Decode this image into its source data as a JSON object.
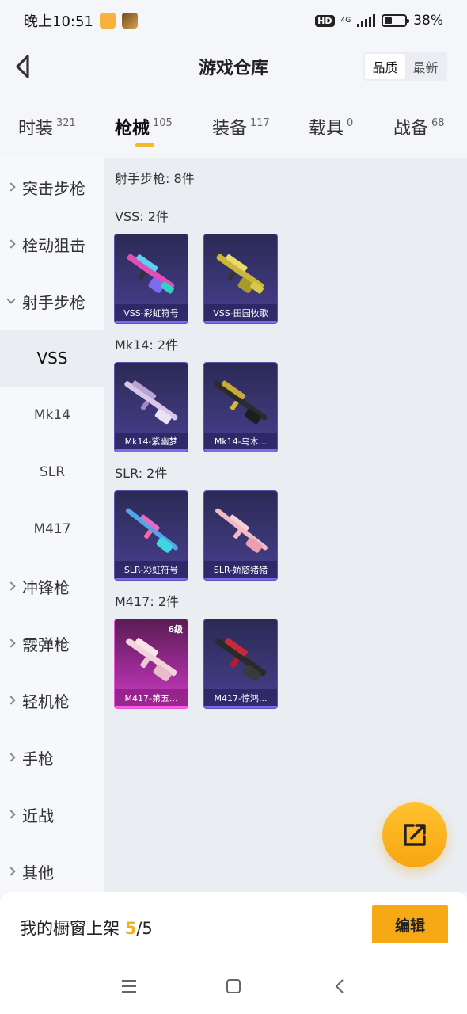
{
  "status_bar": {
    "time": "晚上10:51",
    "hd": "HD",
    "network": "4G",
    "battery": "38%",
    "battery_level": 0.38
  },
  "header": {
    "title": "游戏仓库",
    "sort_options": [
      "品质",
      "最新"
    ],
    "sort_active": "品质"
  },
  "tabs": [
    {
      "label": "时装",
      "count": "321"
    },
    {
      "label": "枪械",
      "count": "105",
      "active": true
    },
    {
      "label": "装备",
      "count": "117"
    },
    {
      "label": "载具",
      "count": "0"
    },
    {
      "label": "战备",
      "count": "68"
    }
  ],
  "sidebar": {
    "categories": [
      "突击步枪",
      "栓动狙击",
      "射手步枪",
      "冲锋枪",
      "霰弹枪",
      "轻机枪",
      "手枪",
      "近战",
      "其他"
    ],
    "expanded": "射手步枪",
    "sub_items": [
      "VSS",
      "Mk14",
      "SLR",
      "M417"
    ],
    "active_sub": "VSS"
  },
  "content": {
    "title": "射手步枪: 8件",
    "groups": [
      {
        "title": "VSS: 2件",
        "items": [
          "VSS-彩虹符号",
          "VSS-田园牧歌"
        ]
      },
      {
        "title": "Mk14: 2件",
        "items": [
          "Mk14-紫幽梦",
          "Mk14-乌木..."
        ]
      },
      {
        "title": "SLR: 2件",
        "items": [
          "SLR-彩虹符号",
          "SLR-娇憨猪猪"
        ]
      },
      {
        "title": "M417: 2件",
        "items": [
          "M417-第五...",
          "M417-惊鸿..."
        ],
        "level": "6级"
      }
    ]
  },
  "bottom": {
    "showcase_label": "我的橱窗上架",
    "showcase_count": "5",
    "showcase_total": "/5",
    "edit_label": "编辑"
  },
  "colors": {
    "accent": "#f4b92a",
    "edit_button": "#f7a915",
    "card_purple": "#3b3675",
    "card_pink": "#a02c9a"
  }
}
